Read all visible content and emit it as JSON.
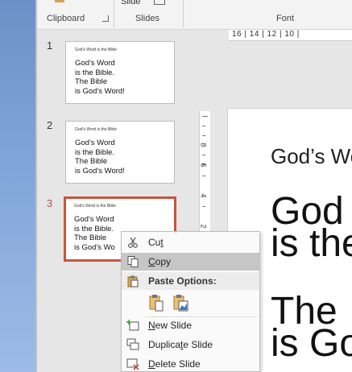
{
  "ribbon": {
    "groups": [
      {
        "label": "Clipboard"
      },
      {
        "label": "Slides"
      },
      {
        "label": "Font"
      }
    ],
    "slide_button_label": "Slide"
  },
  "thumbnails": [
    {
      "number": "1",
      "title": "God's Word is the Bible",
      "lines": [
        "God's Word",
        "is the Bible.",
        "The Bible",
        "is God's Word!"
      ],
      "selected": false
    },
    {
      "number": "2",
      "title": "God's Word is the Bible",
      "lines": [
        "God's Word",
        "is the Bible.",
        "The Bible",
        "is God's Word!"
      ],
      "selected": false
    },
    {
      "number": "3",
      "title": "God's Word is the Bible",
      "lines": [
        "God's Word",
        "is the Bible.",
        "The Bible",
        "is God's Wo"
      ],
      "selected": true
    }
  ],
  "rulers": {
    "horizontal_text": "16 | 14 | 12 | 10 |",
    "vertical_numbers": [
      "8",
      "6",
      "4",
      "2"
    ]
  },
  "canvas": {
    "title": "God’s Wo",
    "body_lines_top": [
      "God",
      "is the"
    ],
    "body_lines_bottom": [
      "The",
      "is Go"
    ]
  },
  "context_menu": {
    "items": [
      {
        "label": "Cut",
        "underline_index": 2,
        "icon": "scissors-icon"
      },
      {
        "label": "Copy",
        "underline_index": 0,
        "icon": "copy-icon",
        "highlighted": true
      }
    ],
    "paste_header": "Paste Options:",
    "paste_options": [
      "paste-keep-formatting-icon",
      "paste-picture-icon"
    ],
    "lower_items": [
      {
        "label": "New Slide",
        "underline_index": 0,
        "icon": "new-slide-icon"
      },
      {
        "label": "Duplicate Slide",
        "underline_index": 7,
        "icon": "duplicate-slide-icon"
      },
      {
        "label": "Delete Slide",
        "underline_index": 0,
        "icon": "delete-slide-icon"
      }
    ]
  },
  "colors": {
    "selection_border": "#c8553a",
    "active_number": "#c0504d",
    "menu_highlight": "#c6c6c6"
  }
}
